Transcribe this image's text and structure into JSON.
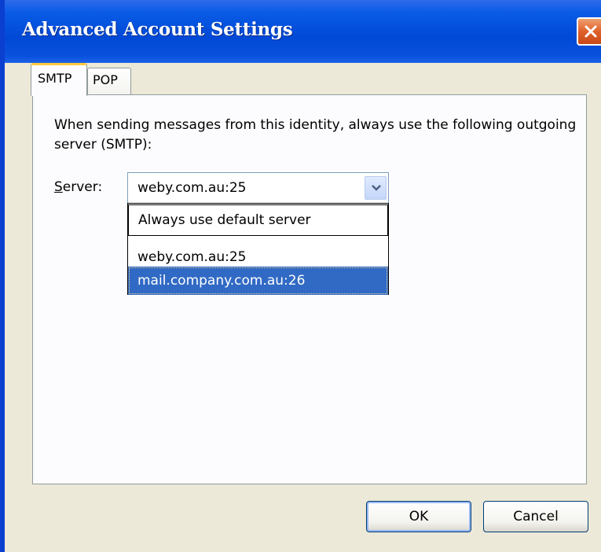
{
  "window": {
    "title": "Advanced Account Settings"
  },
  "tabs": [
    {
      "label": "SMTP",
      "selected": true
    },
    {
      "label": "POP",
      "selected": false
    }
  ],
  "smtp_panel": {
    "description": "When sending messages from this identity, always use the following outgoing server (SMTP):",
    "server_label_first": "S",
    "server_label_rest": "erver:",
    "server_value": "weby.com.au:25",
    "options": [
      "Always use default server",
      "weby.com.au:25",
      "mail.company.com.au:26"
    ],
    "highlighted_option": "mail.company.com.au:26"
  },
  "buttons": {
    "ok": "OK",
    "cancel": "Cancel"
  },
  "colors": {
    "titlebar": "#0049D6",
    "selection": "#316AC5",
    "dialog_bg": "#ECE9D8",
    "tab_accent": "#FFC83C"
  }
}
